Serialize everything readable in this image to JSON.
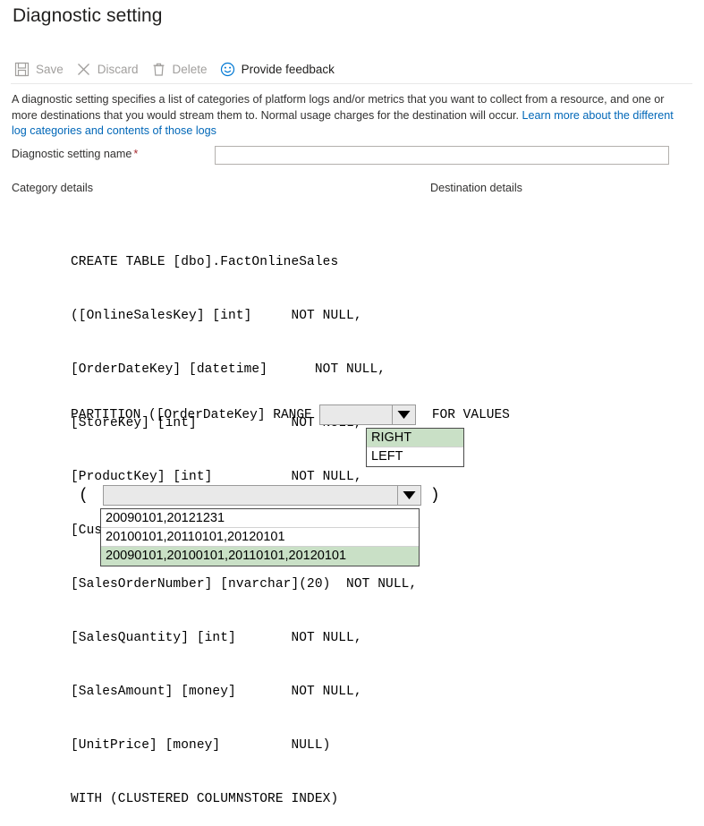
{
  "page": {
    "title": "Diagnostic setting"
  },
  "toolbar": {
    "buttons": [
      {
        "label": "Save",
        "icon": "save-icon",
        "enabled": false
      },
      {
        "label": "Discard",
        "icon": "discard-icon",
        "enabled": false
      },
      {
        "label": "Delete",
        "icon": "delete-icon",
        "enabled": false
      },
      {
        "label": "Provide feedback",
        "icon": "feedback-icon",
        "enabled": true
      }
    ]
  },
  "description": {
    "text_before_link": "A diagnostic setting specifies a list of categories of platform logs and/or metrics that you want to collect from a resource, and one or more destinations that you would stream them to. Normal usage charges for the destination will occur. ",
    "link_text": "Learn more about the different log categories and contents of those logs"
  },
  "form": {
    "name_label": "Diagnostic setting name",
    "required_marker": "*",
    "name_value": "",
    "name_placeholder": ""
  },
  "sections": {
    "category_details": "Category details",
    "destination_details": "Destination details"
  },
  "sql": {
    "lines": [
      "CREATE TABLE [dbo].FactOnlineSales",
      "([OnlineSalesKey] [int]     NOT NULL,",
      "[OrderDateKey] [datetime]      NOT NULL,",
      "[StoreKey] [int]            NOT NULL,",
      "[ProductKey] [int]          NOT NULL,",
      "[CustomerKey] [int]         NOT NULL,",
      "[SalesOrderNumber] [nvarchar](20)  NOT NULL,",
      "[SalesQuantity] [int]       NOT NULL,",
      "[SalesAmount] [money]       NOT NULL,",
      "[UnitPrice] [money]         NULL)",
      "WITH (CLUSTERED COLUMNSTORE INDEX)"
    ],
    "partition_prefix": "PARTITION ([OrderDateKey] RANGE ",
    "partition_suffix": "  FOR VALUES",
    "open_paren": "(",
    "close_paren": ")"
  },
  "range_dropdown": {
    "value": "",
    "options": [
      {
        "label": "RIGHT",
        "selected": true
      },
      {
        "label": "LEFT",
        "selected": false
      }
    ]
  },
  "values_dropdown": {
    "value": "",
    "options": [
      {
        "label": "20090101,20121231",
        "selected": false
      },
      {
        "label": "20100101,20110101,20120101",
        "selected": false
      },
      {
        "label": "20090101,20100101,20110101,20120101",
        "selected": true
      }
    ]
  },
  "colors": {
    "accent": "#0067b8",
    "required": "#a4262c",
    "selected_option": "#c9e0c6",
    "combo_face": "#e9e9e9",
    "disabled_text": "#a19f9d"
  }
}
